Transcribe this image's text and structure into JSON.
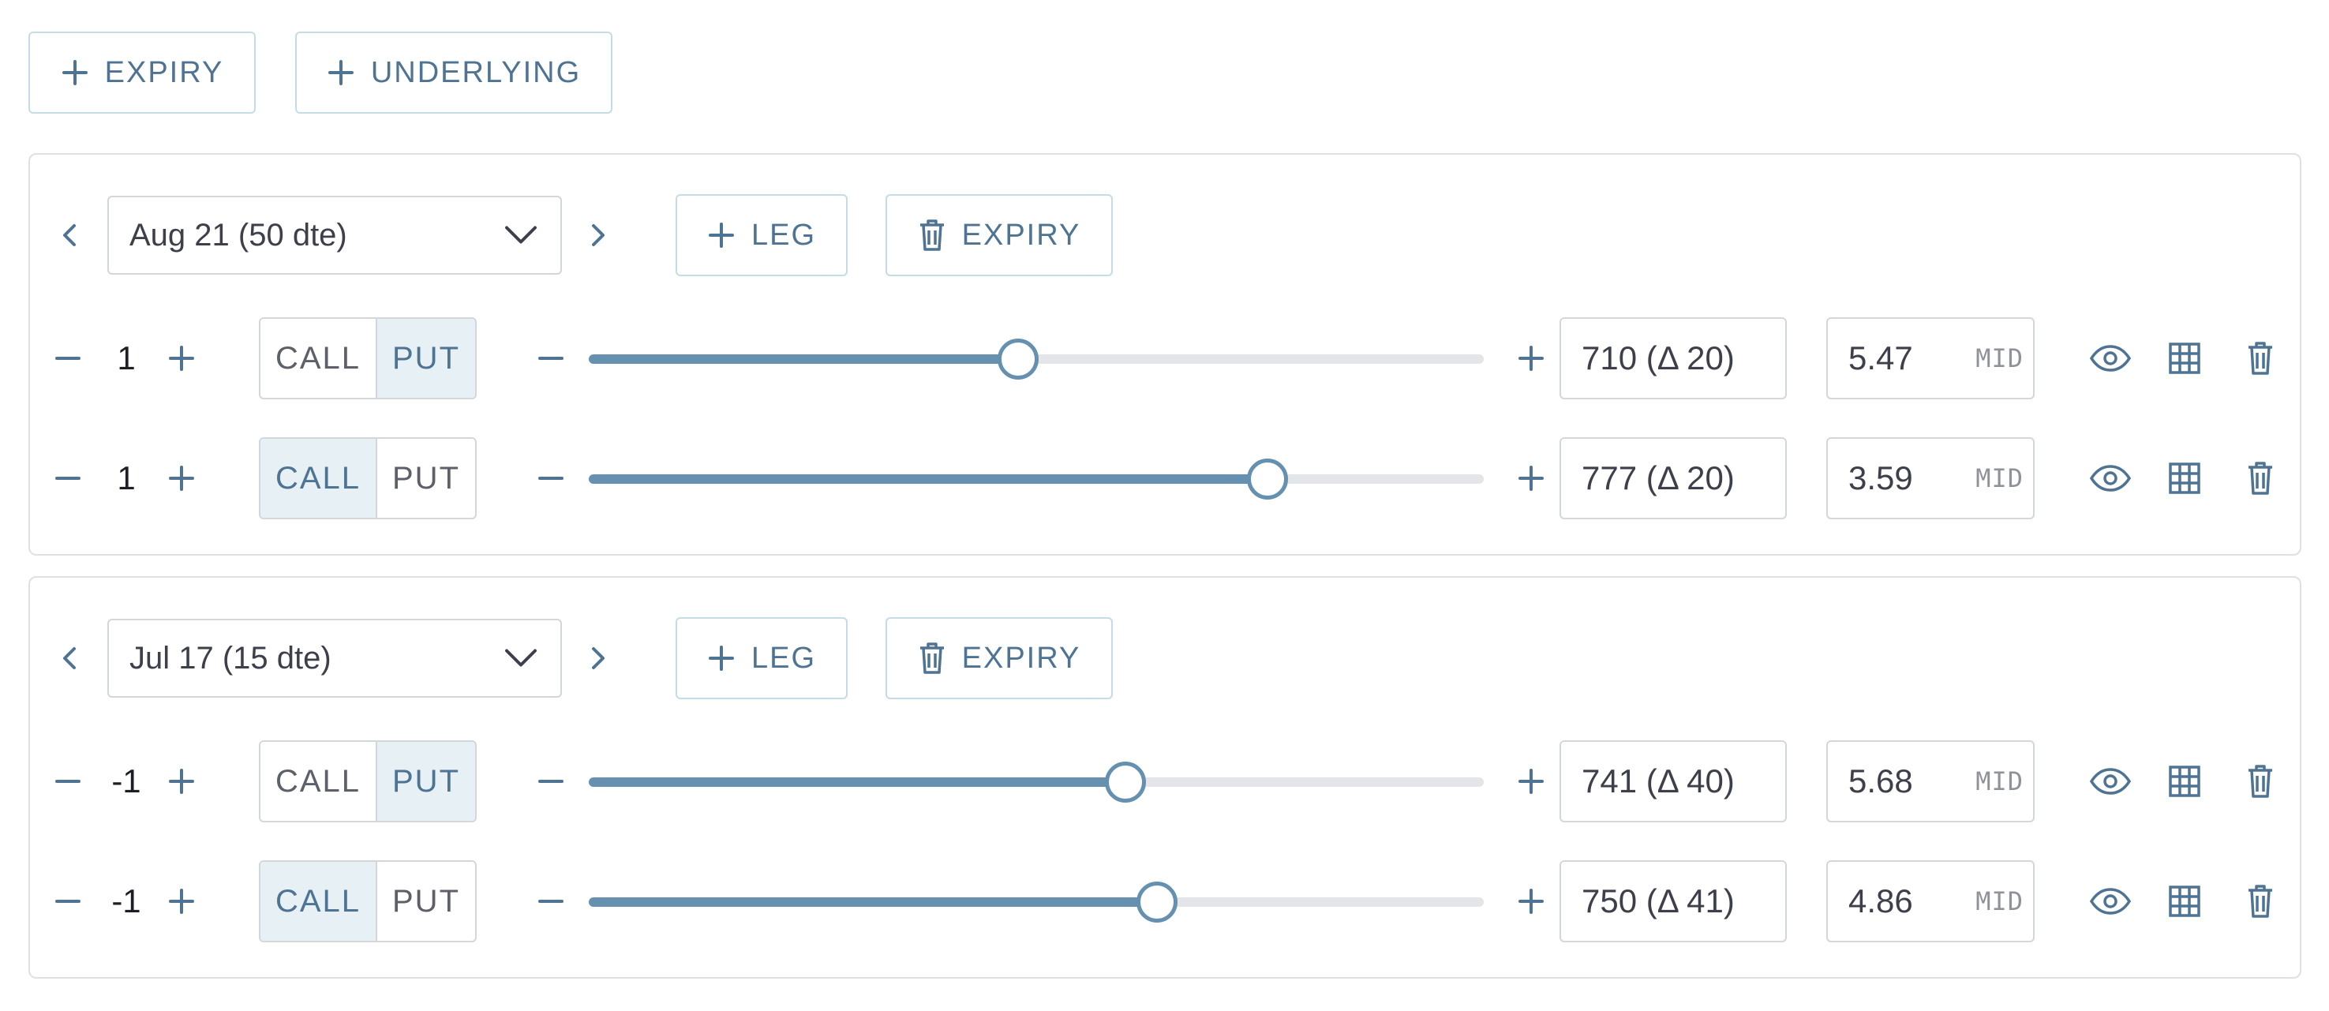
{
  "toolbar": {
    "add_expiry_label": "EXPIRY",
    "add_underlying_label": "UNDERLYING"
  },
  "colors": {
    "accent": "#4e7393",
    "slider": "#6590b0",
    "toggle_active_bg": "#e6f0f5",
    "border": "#d3d6db"
  },
  "expiries": [
    {
      "date_label": "Aug 21 (50 dte)",
      "add_leg_label": "LEG",
      "delete_expiry_label": "EXPIRY",
      "legs": [
        {
          "qty": "1",
          "call_label": "CALL",
          "put_label": "PUT",
          "type": "put",
          "slider_value": 0.48,
          "strike": "710 (Δ 20)",
          "price": "5.47",
          "price_mode": "MID"
        },
        {
          "qty": "1",
          "call_label": "CALL",
          "put_label": "PUT",
          "type": "call",
          "slider_value": 0.758,
          "strike": "777 (Δ 20)",
          "price": "3.59",
          "price_mode": "MID"
        }
      ]
    },
    {
      "date_label": "Jul 17 (15 dte)",
      "add_leg_label": "LEG",
      "delete_expiry_label": "EXPIRY",
      "legs": [
        {
          "qty": "-1",
          "call_label": "CALL",
          "put_label": "PUT",
          "type": "put",
          "slider_value": 0.6,
          "strike": "741 (Δ 40)",
          "price": "5.68",
          "price_mode": "MID"
        },
        {
          "qty": "-1",
          "call_label": "CALL",
          "put_label": "PUT",
          "type": "call",
          "slider_value": 0.635,
          "strike": "750 (Δ 41)",
          "price": "4.86",
          "price_mode": "MID"
        }
      ]
    }
  ]
}
